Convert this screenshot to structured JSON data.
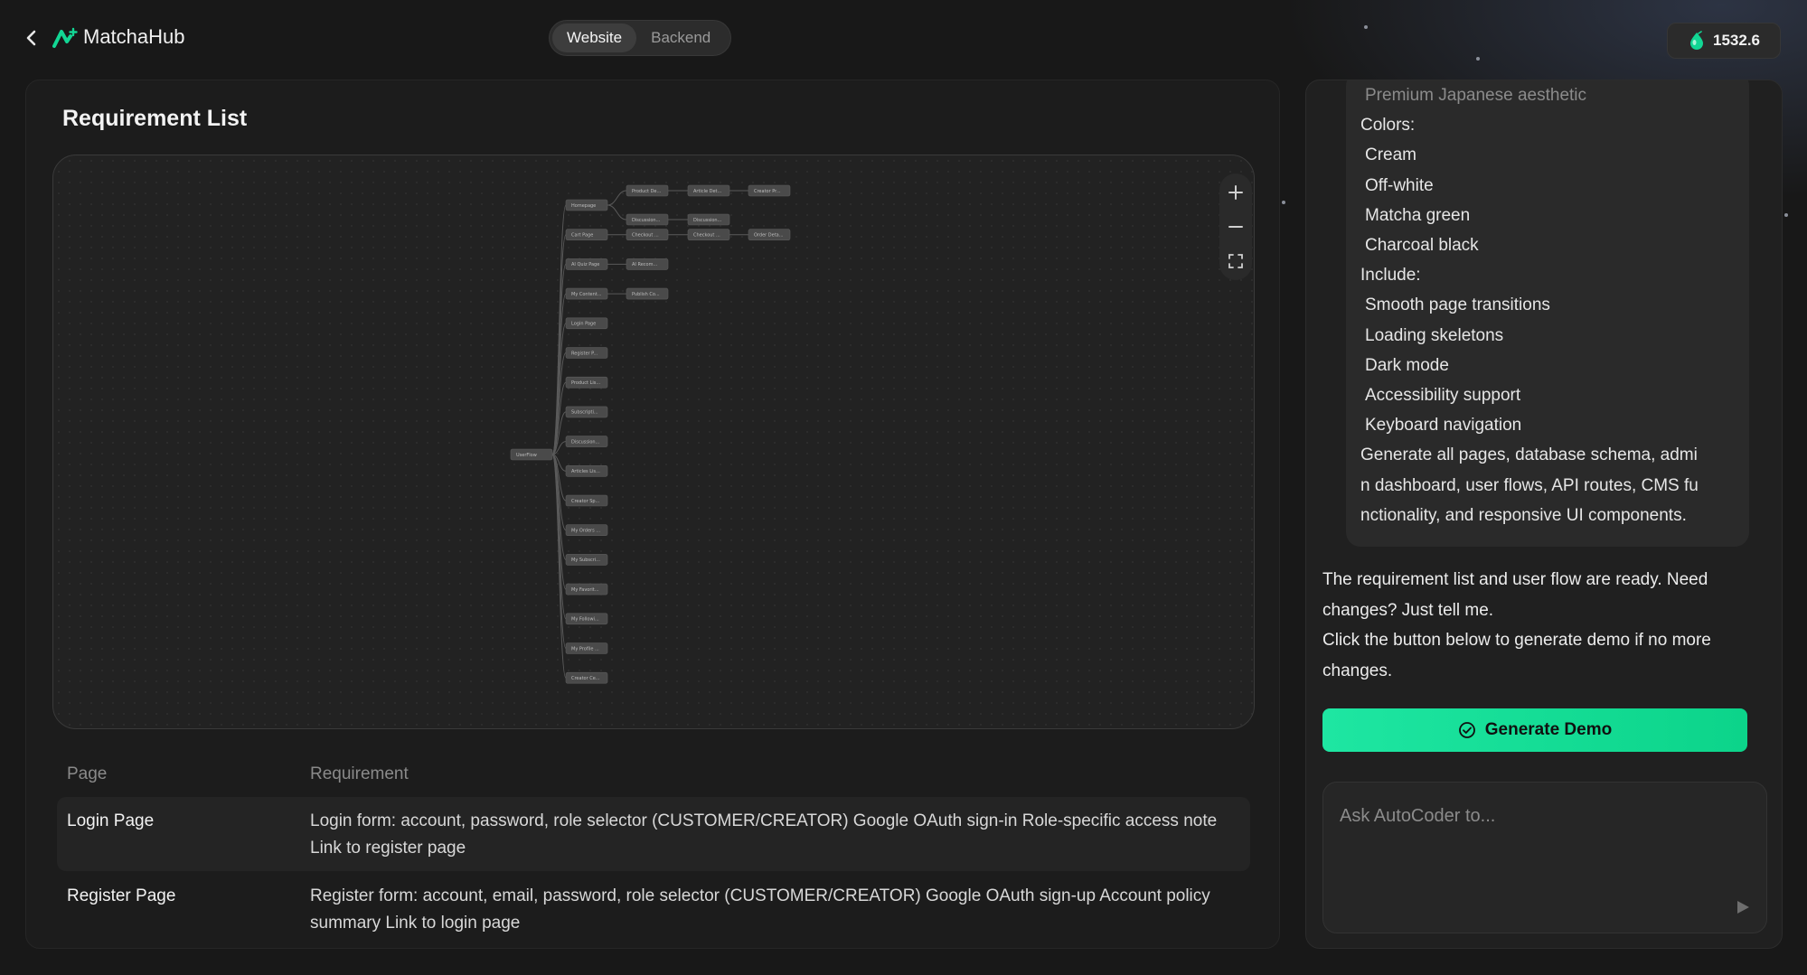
{
  "header": {
    "app_title": "MatchaHub",
    "toggle": [
      "Website",
      "Backend"
    ],
    "active_toggle": "Website",
    "credits": "1532.6"
  },
  "colors": {
    "accent": "#12d694",
    "background": "#181818"
  },
  "left": {
    "title": "Requirement List",
    "flow": {
      "root": "UserFlow",
      "nodes": [
        "Homepage",
        "Product De...",
        "Article Det...",
        "Creator Pr...",
        "Discussion...",
        "Discussion...",
        "Cart Page",
        "Checkout ...",
        "Checkout ...",
        "Order Deta...",
        "AI Quiz Page",
        "AI Recom...",
        "My Content...",
        "Publish Co...",
        "Login Page",
        "Register P...",
        "Product Lis...",
        "Subscripti...",
        "Discussion...",
        "Articles Lis...",
        "Creator Sp...",
        "My Orders ...",
        "My Subscri...",
        "My Favorit...",
        "My Followi...",
        "My Profile ...",
        "Creator Ce..."
      ]
    },
    "table": {
      "headers": [
        "Page",
        "Requirement"
      ],
      "rows": [
        {
          "page": "Login Page",
          "requirement": "Login form: account, password, role selector (CUSTOMER/CREATOR) Google OAuth sign-in Role-specific access note Link to register page"
        },
        {
          "page": "Register Page",
          "requirement": "Register form: account, email, password, role selector (CUSTOMER/CREATOR) Google OAuth sign-up Account policy summary Link to login page"
        }
      ]
    }
  },
  "right": {
    "prompt_lines": [
      "Premium Japanese aesthetic",
      "Colors:",
      "Cream",
      "Off-white",
      "Matcha green",
      "Charcoal black",
      "Include:",
      "Smooth page transitions",
      "Loading skeletons",
      "Dark mode",
      "Accessibility support",
      "Keyboard navigation",
      "Generate all pages, database schema, admi",
      "n dashboard, user flows, API routes, CMS fu",
      "nctionality, and responsive UI components."
    ],
    "assistant_message": [
      "The requirement list and user flow are ready. Need changes? Just tell me.",
      "Click the button below to generate demo if no more changes."
    ],
    "generate_button": "Generate Demo",
    "ask_placeholder": "Ask AutoCoder to..."
  }
}
